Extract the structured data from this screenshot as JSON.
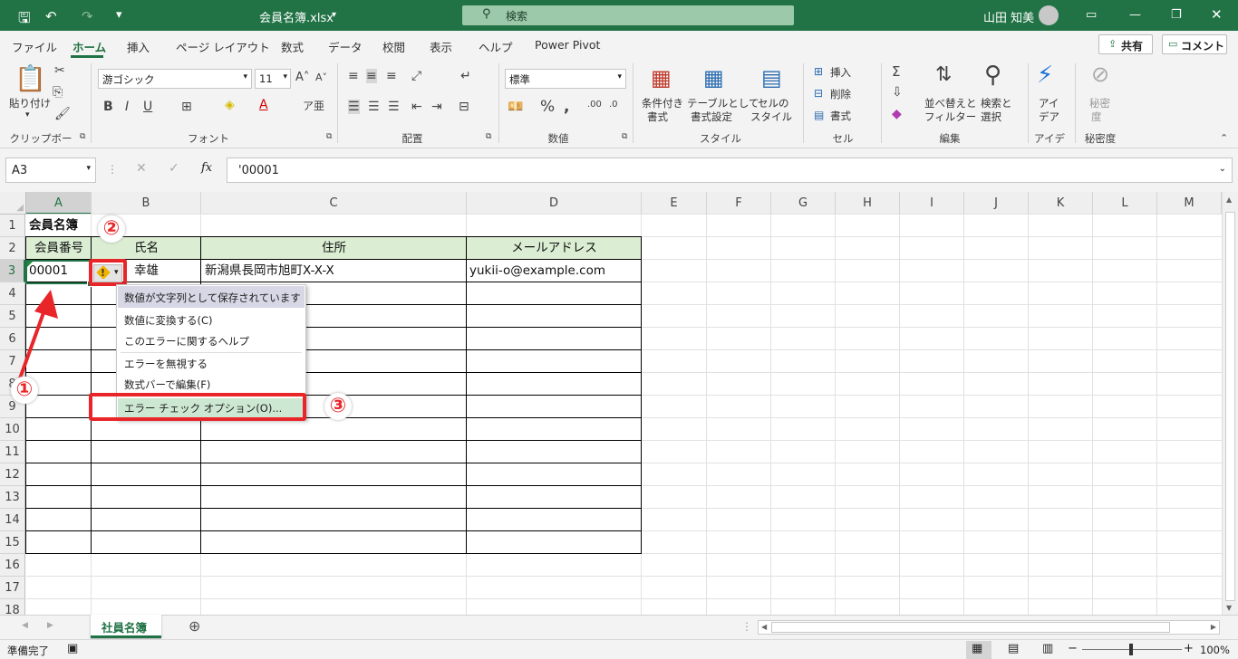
{
  "title_bar": {
    "file_name": "会員名簿.xlsx",
    "dropdown": "▾",
    "search_placeholder": "検索",
    "user_name": "山田 知美"
  },
  "ribbon_tabs": [
    "ファイル",
    "ホーム",
    "挿入",
    "ページ レイアウト",
    "数式",
    "データ",
    "校閲",
    "表示",
    "ヘルプ",
    "Power Pivot"
  ],
  "share_label": "共有",
  "comment_label": "コメント",
  "ribbon": {
    "paste": "貼り付け",
    "font_name": "游ゴシック",
    "font_size": "11",
    "number_format": "標準",
    "cond_format": [
      "条件付き",
      "書式"
    ],
    "table_format": [
      "テーブルとして",
      "書式設定"
    ],
    "cell_style": [
      "セルの",
      "スタイル"
    ],
    "insert": "挿入",
    "delete": "削除",
    "format": "書式",
    "sort_filter": [
      "並べ替えと",
      "フィルター"
    ],
    "find_select": [
      "検索と",
      "選択"
    ],
    "ideas": [
      "アイ",
      "デア"
    ],
    "sensitivity": [
      "秘密",
      "度"
    ],
    "groups": [
      "クリップボード",
      "フォント",
      "配置",
      "数値",
      "スタイル",
      "セル",
      "編集",
      "アイデア",
      "秘密度"
    ]
  },
  "formula_bar": {
    "name_box": "A3",
    "formula": "'00001",
    "fx": "fx"
  },
  "columns": [
    "A",
    "B",
    "C",
    "D",
    "E",
    "F",
    "G",
    "H",
    "I",
    "J",
    "K",
    "L",
    "M"
  ],
  "rows": [
    "1",
    "2",
    "3",
    "4",
    "5",
    "6",
    "7",
    "8",
    "9",
    "10",
    "11",
    "12",
    "13",
    "14",
    "15",
    "16",
    "17",
    "18"
  ],
  "sheet": {
    "title": "会員名簿",
    "headers": [
      "会員番号",
      "氏名",
      "住所",
      "メールアドレス"
    ],
    "row3": {
      "id": "00001",
      "name": "幸雄",
      "address": "新潟県長岡市旭町X-X-X",
      "email": "yukii-o@example.com"
    }
  },
  "error_menu": {
    "header": "数値が文字列として保存されています",
    "items": [
      "数値に変換する(C)",
      "このエラーに関するヘルプ",
      "エラーを無視する",
      "数式バーで編集(F)",
      "エラー チェック オプション(O)..."
    ]
  },
  "annotations": [
    "①",
    "②",
    "③"
  ],
  "sheet_tab": "社員名簿",
  "status": {
    "ready": "準備完了",
    "zoom": "100%"
  }
}
